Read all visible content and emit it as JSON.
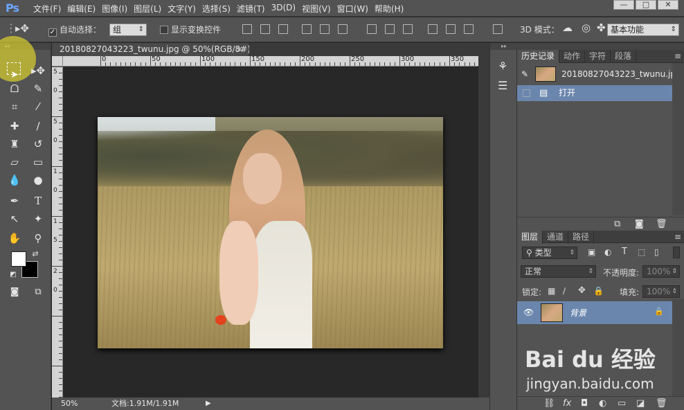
{
  "app": {
    "logo": "Ps"
  },
  "menubar": {
    "items": [
      "文件(F)",
      "编辑(E)",
      "图像(I)",
      "图层(L)",
      "文字(Y)",
      "选择(S)",
      "滤镜(T)",
      "3D(D)",
      "视图(V)",
      "窗口(W)",
      "帮助(H)"
    ]
  },
  "window_controls": {
    "minimize": "—",
    "maximize": "□",
    "close": "✕"
  },
  "options_bar": {
    "auto_select_label": "自动选择：",
    "auto_select_checked": true,
    "auto_select_value": "组",
    "transform_controls_label": "显示变换控件",
    "mode_3d_label": "3D 模式：",
    "workspace_value": "基本功能"
  },
  "document": {
    "tab_title": "20180827043223_twunu.jpg @ 50%(RGB/8#)",
    "close": "×",
    "zoom": "50%",
    "doc_size": "文档:1.91M/1.91M"
  },
  "ruler": {
    "h_labels": [
      "0",
      "50",
      "100",
      "150",
      "200",
      "250",
      "300",
      "350"
    ],
    "v_labels": [
      "5",
      "0",
      "5",
      "0",
      "1",
      "0",
      "1",
      "5",
      "2",
      "0"
    ]
  },
  "history_panel": {
    "tabs": [
      "历史记录",
      "动作",
      "字符",
      "段落"
    ],
    "snapshot": "20180827043223_twunu.jpg",
    "states": [
      "打开"
    ]
  },
  "layers_panel": {
    "tabs": [
      "图层",
      "通道",
      "路径"
    ],
    "filter_type": "类型",
    "blend_mode": "正常",
    "opacity_label": "不透明度:",
    "opacity_value": "100%",
    "lock_label": "锁定:",
    "fill_label": "填充:",
    "fill_value": "100%",
    "layers": [
      {
        "name": "背景",
        "visible": true,
        "locked": true
      }
    ]
  },
  "watermark": {
    "brand": "Bai du 经验",
    "url": "jingyan.baidu.com"
  },
  "colors": {
    "accent": "#6b86ad",
    "panel": "#535353",
    "workspace": "#282828"
  }
}
